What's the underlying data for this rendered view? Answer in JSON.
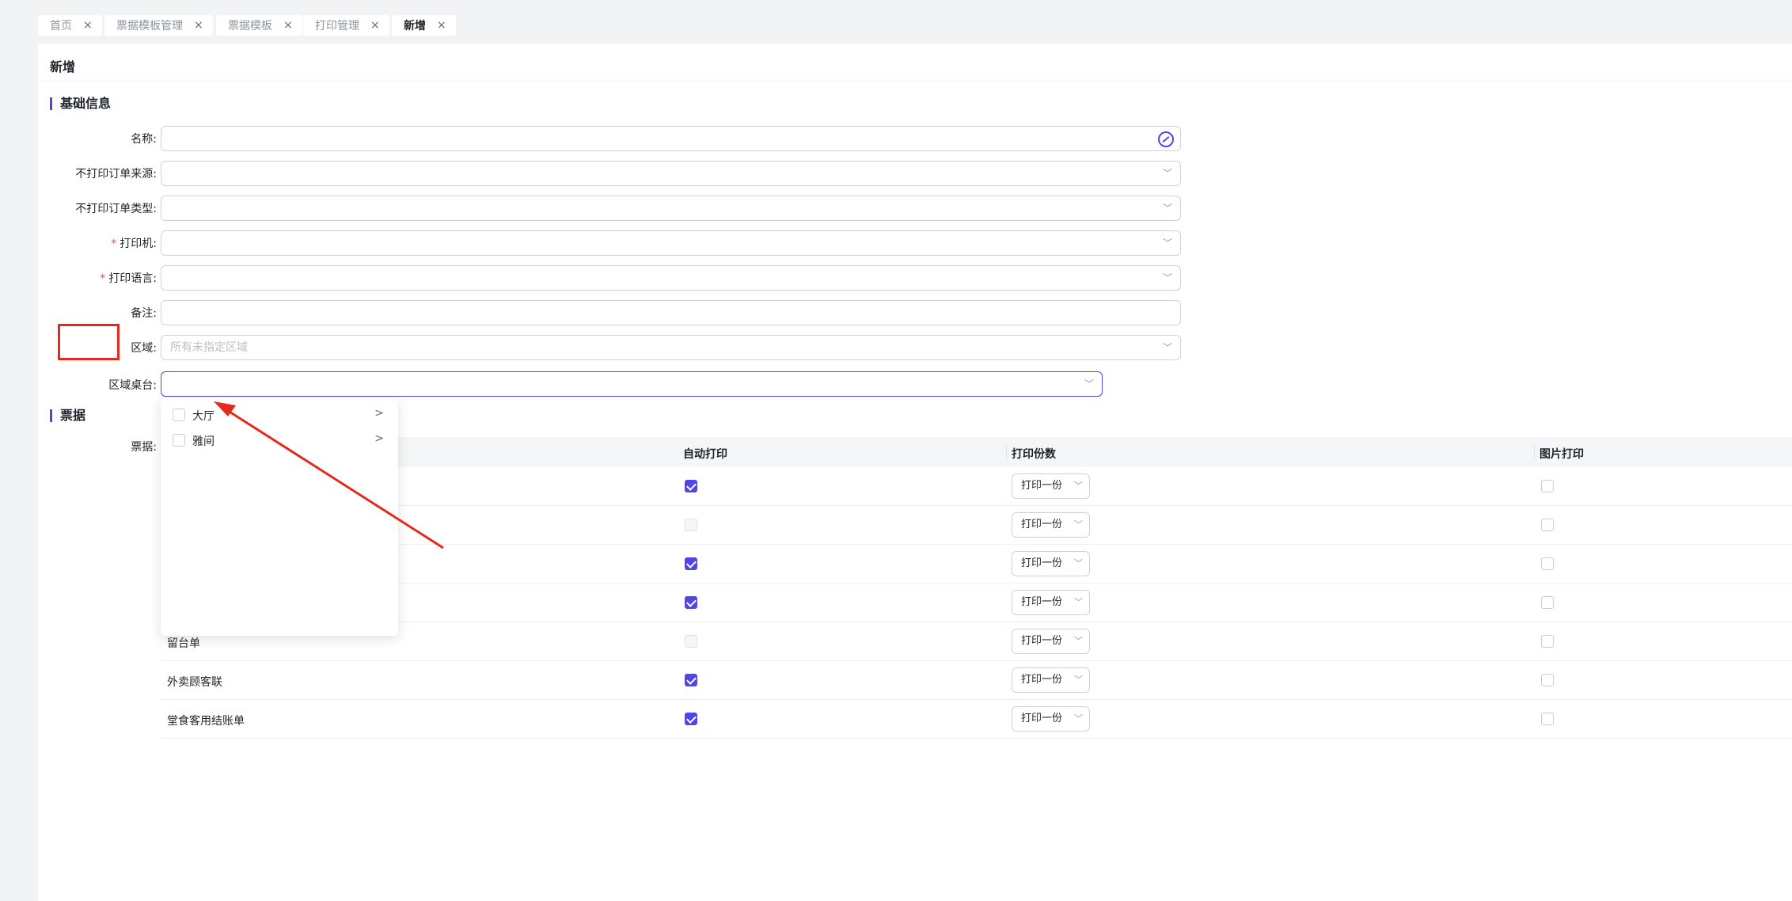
{
  "tabs": [
    {
      "label": "首页",
      "close": "×"
    },
    {
      "label": "票据模板管理",
      "close": "×"
    },
    {
      "label": "票据模板",
      "close": "×"
    },
    {
      "label": "打印管理",
      "close": "×"
    },
    {
      "label": "新增",
      "close": "×",
      "active": true
    }
  ],
  "page_title": "新增",
  "sections": {
    "basic": "基础信息",
    "tickets": "票据"
  },
  "form": {
    "name_label": "名称:",
    "source_label": "不打印订单来源:",
    "type_label": "不打印订单类型:",
    "printer_label": "打印机:",
    "language_label": "打印语言:",
    "remark_label": "备注:",
    "area_label": "区域:",
    "area_placeholder": "所有未指定区域",
    "table_label": "区域桌台:",
    "tickets_label": "票据:",
    "required_mark": "*"
  },
  "table": {
    "headers": [
      "自动打印",
      "打印份数",
      "图片打印"
    ],
    "rows": [
      {
        "name": "",
        "auto": true,
        "auto_enabled": true,
        "copies": "打印一份"
      },
      {
        "name": "",
        "auto": false,
        "auto_enabled": false,
        "copies": "打印一份"
      },
      {
        "name": "",
        "auto": true,
        "auto_enabled": true,
        "copies": "打印一份"
      },
      {
        "name": "",
        "auto": true,
        "auto_enabled": true,
        "copies": "打印一份"
      },
      {
        "name": "留台单",
        "auto": false,
        "auto_enabled": false,
        "copies": "打印一份"
      },
      {
        "name": "外卖顾客联",
        "auto": true,
        "auto_enabled": true,
        "copies": "打印一份"
      },
      {
        "name": "堂食客用结账单",
        "auto": true,
        "auto_enabled": true,
        "copies": "打印一份"
      }
    ]
  },
  "dropdown": {
    "items": [
      {
        "label": "大厅",
        "arrow": ">"
      },
      {
        "label": "雅间",
        "arrow": ">"
      }
    ]
  },
  "colors": {
    "accent": "#4f46e5",
    "annotation": "#e5291f"
  },
  "icons": {
    "chevron": "chevron-down-icon",
    "translate": "translate-icon"
  }
}
